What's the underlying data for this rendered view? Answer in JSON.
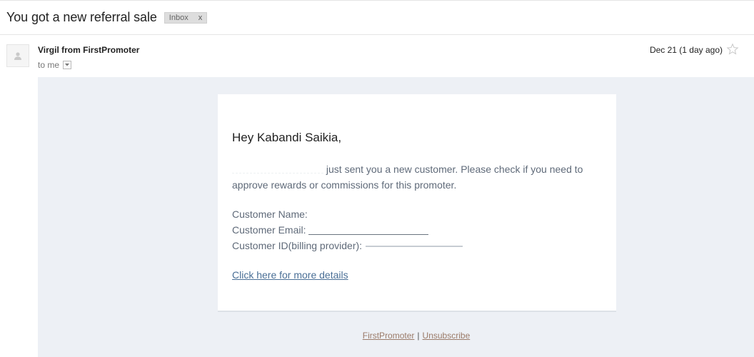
{
  "email": {
    "subject": "You got a new referral sale",
    "label": {
      "text": "Inbox",
      "remove": "x"
    },
    "sender": "Virgil from FirstPromoter",
    "recipient": "to me",
    "date": "Dec 21 (1 day ago)"
  },
  "content": {
    "greeting": "Hey Kabandi Saikia,",
    "message": "just sent you a new customer. Please check if you need to approve rewards or commissions for this promoter.",
    "customer_name_label": "Customer Name:",
    "customer_email_label": "Customer Email:",
    "customer_id_label": "Customer ID(billing provider):",
    "details_link": "Click here for more details"
  },
  "footer": {
    "brand_link": "FirstPromoter",
    "separator": "|",
    "unsubscribe_link": "Unsubscribe"
  },
  "icons": {
    "avatar": "person-icon",
    "dropdown": "chevron-down-icon",
    "star": "star-icon"
  },
  "colors": {
    "body_background": "#edf0f5",
    "link": "#4a6f96",
    "footer_link": "#9a7a68"
  }
}
